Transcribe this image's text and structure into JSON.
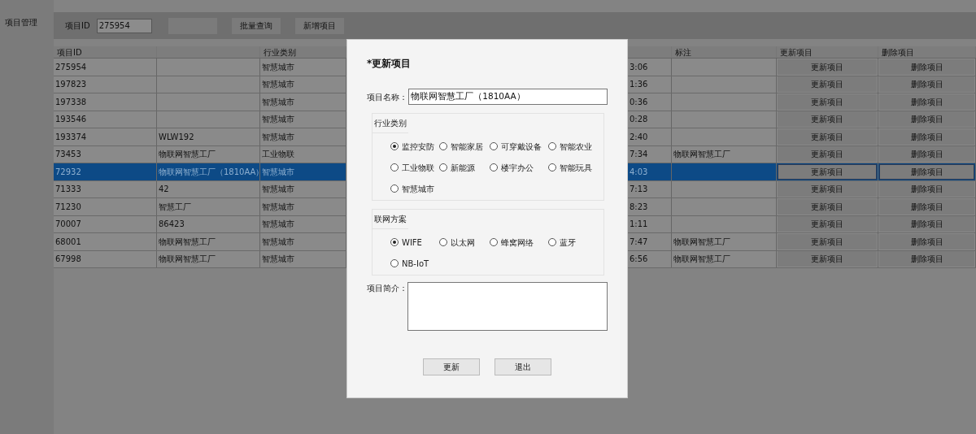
{
  "sidebar": {
    "items": [
      {
        "label": "项目管理"
      }
    ]
  },
  "toolbar": {
    "id_label": "项目ID",
    "id_value": "275954",
    "buttons": [
      "批量查询",
      "新增项目"
    ]
  },
  "table": {
    "columns": [
      {
        "label": "项目ID"
      },
      {},
      {
        "label": "行业类别"
      },
      {},
      {},
      {
        "label": "标注"
      },
      {
        "label": "更新项目"
      },
      {
        "label": "删除项目"
      }
    ],
    "rows": [
      {
        "selected": false,
        "cells": [
          {
            "text": "275954"
          },
          {},
          {
            "text": "智慧城市"
          },
          {},
          {
            "text": "3:06"
          },
          {},
          {
            "kind": "button",
            "text": "更新项目"
          },
          {
            "kind": "button",
            "text": "删除项目"
          }
        ]
      },
      {
        "selected": false,
        "cells": [
          {
            "text": "197823"
          },
          {},
          {
            "text": "智慧城市"
          },
          {},
          {
            "text": "1:36"
          },
          {},
          {
            "kind": "button",
            "text": "更新项目"
          },
          {
            "kind": "button",
            "text": "删除项目"
          }
        ]
      },
      {
        "selected": false,
        "cells": [
          {
            "text": "197338"
          },
          {},
          {
            "text": "智慧城市"
          },
          {},
          {
            "text": "0:36"
          },
          {},
          {
            "kind": "button",
            "text": "更新项目"
          },
          {
            "kind": "button",
            "text": "删除项目"
          }
        ]
      },
      {
        "selected": false,
        "cells": [
          {
            "text": "193546"
          },
          {},
          {
            "text": "智慧城市"
          },
          {},
          {
            "text": "0:28"
          },
          {},
          {
            "kind": "button",
            "text": "更新项目"
          },
          {
            "kind": "button",
            "text": "删除项目"
          }
        ]
      },
      {
        "selected": false,
        "cells": [
          {
            "text": "193374"
          },
          {
            "text": "WLW192"
          },
          {
            "text": "智慧城市"
          },
          {},
          {
            "text": "2:40"
          },
          {},
          {
            "kind": "button",
            "text": "更新项目"
          },
          {
            "kind": "button",
            "text": "删除项目"
          }
        ]
      },
      {
        "selected": false,
        "cells": [
          {
            "text": "73453"
          },
          {
            "text": "物联网智慧工厂"
          },
          {
            "text": "工业物联"
          },
          {},
          {
            "text": "7:34"
          },
          {
            "text": "物联网智慧工厂"
          },
          {
            "kind": "button",
            "text": "更新项目"
          },
          {
            "kind": "button",
            "text": "删除项目"
          }
        ]
      },
      {
        "selected": true,
        "cells": [
          {
            "text": "72932"
          },
          {
            "text": "物联网智慧工厂（1810AA）"
          },
          {
            "text": "智慧城市"
          },
          {},
          {
            "text": "4:03"
          },
          {},
          {
            "kind": "button",
            "text": "更新项目"
          },
          {
            "kind": "button",
            "text": "删除项目"
          }
        ]
      },
      {
        "selected": false,
        "cells": [
          {
            "text": "71333"
          },
          {
            "text": "42"
          },
          {
            "text": "智慧城市"
          },
          {},
          {
            "text": "7:13"
          },
          {},
          {
            "kind": "button",
            "text": "更新项目"
          },
          {
            "kind": "button",
            "text": "删除项目"
          }
        ]
      },
      {
        "selected": false,
        "cells": [
          {
            "text": "71230"
          },
          {
            "text": "智慧工厂"
          },
          {
            "text": "智慧城市"
          },
          {},
          {
            "text": "8:23"
          },
          {},
          {
            "kind": "button",
            "text": "更新项目"
          },
          {
            "kind": "button",
            "text": "删除项目"
          }
        ]
      },
      {
        "selected": false,
        "cells": [
          {
            "text": "70007"
          },
          {
            "text": "86423"
          },
          {
            "text": "智慧城市"
          },
          {},
          {
            "text": "1:11"
          },
          {},
          {
            "kind": "button",
            "text": "更新项目"
          },
          {
            "kind": "button",
            "text": "删除项目"
          }
        ]
      },
      {
        "selected": false,
        "cells": [
          {
            "text": "68001"
          },
          {
            "text": "物联网智慧工厂"
          },
          {
            "text": "智慧城市"
          },
          {},
          {
            "text": "7:47"
          },
          {
            "text": "物联网智慧工厂"
          },
          {
            "kind": "button",
            "text": "更新项目"
          },
          {
            "kind": "button",
            "text": "删除项目"
          }
        ]
      },
      {
        "selected": false,
        "cells": [
          {
            "text": "67998"
          },
          {
            "text": "物联网智慧工厂"
          },
          {
            "text": "智慧城市"
          },
          {},
          {
            "text": "6:56"
          },
          {
            "text": "物联网智慧工厂"
          },
          {
            "kind": "button",
            "text": "更新项目"
          },
          {
            "kind": "button",
            "text": "删除项目"
          }
        ]
      }
    ]
  },
  "modal": {
    "title": "*更新项目",
    "name_label": "项目名称：",
    "name_value": "物联网智慧工厂（1810AA）",
    "industry": {
      "title": "行业类别",
      "options": [
        {
          "label": "监控安防",
          "selected": true
        },
        {
          "label": "智能家居",
          "selected": false
        },
        {
          "label": "可穿戴设备",
          "selected": false
        },
        {
          "label": "智能农业",
          "selected": false
        },
        {
          "label": "工业物联",
          "selected": false
        },
        {
          "label": "新能源",
          "selected": false
        },
        {
          "label": "楼宇办公",
          "selected": false
        },
        {
          "label": "智能玩具",
          "selected": false
        },
        {
          "label": "智慧城市",
          "selected": false
        }
      ]
    },
    "network": {
      "title": "联网方案",
      "options": [
        {
          "label": "WIFE",
          "selected": true
        },
        {
          "label": "以太网",
          "selected": false
        },
        {
          "label": "蜂窝网络",
          "selected": false
        },
        {
          "label": "蓝牙",
          "selected": false
        },
        {
          "label": "NB-IoT",
          "selected": false
        }
      ]
    },
    "intro_label": "项目简介：",
    "buttons": [
      "更新",
      "退出"
    ]
  }
}
